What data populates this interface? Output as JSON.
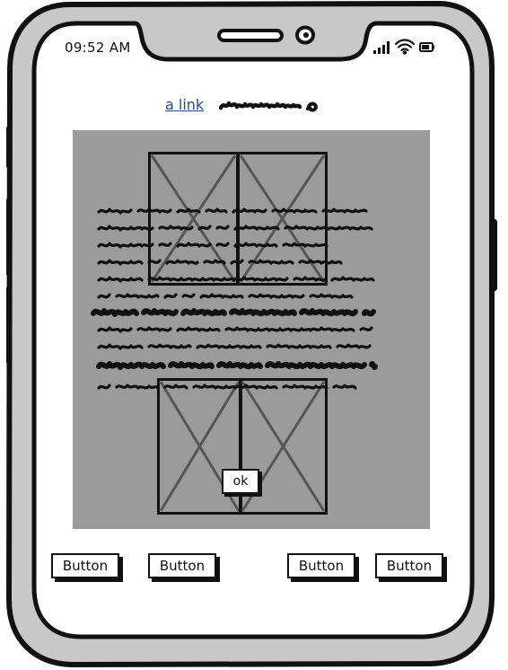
{
  "status_bar": {
    "time": "09:52 AM",
    "icons": [
      "signal-icon",
      "wifi-icon",
      "battery-icon"
    ]
  },
  "header": {
    "link_label": "a link"
  },
  "content": {
    "image_placeholders": [
      "image-placeholder-top-left",
      "image-placeholder-top-right",
      "image-placeholder-bottom-left",
      "image-placeholder-bottom-right"
    ],
    "ok_label": "ok"
  },
  "bottom_bar": {
    "buttons": [
      "Button",
      "Button",
      "Button",
      "Button"
    ]
  },
  "colors": {
    "frame": "#c8c8c8",
    "outline": "#111111",
    "panel": "#9b9b9b",
    "link": "#1f4e99"
  }
}
